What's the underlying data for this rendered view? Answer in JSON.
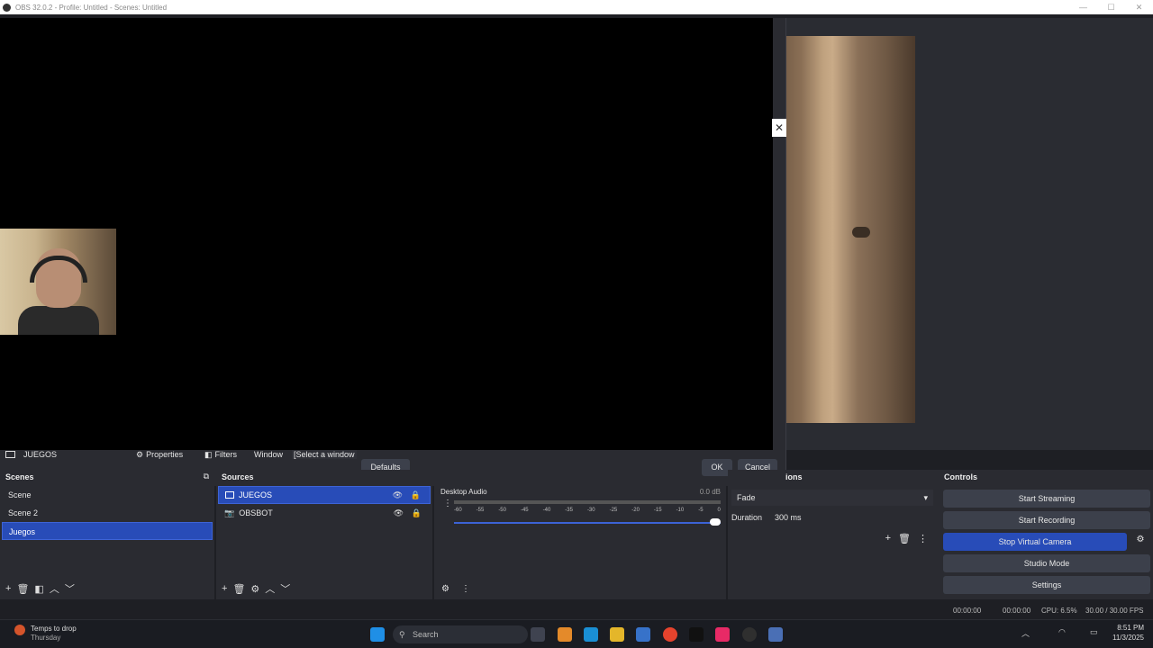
{
  "window": {
    "title": "OBS 32.0.2 - Profile: Untitled - Scenes: Untitled",
    "minimize": "—",
    "maximize": "☐",
    "close": "✕"
  },
  "dialog": {
    "close_glyph": "✕",
    "defaults_label": "Defaults",
    "ok_label": "OK",
    "cancel_label": "Cancel"
  },
  "source_toolbar": {
    "source_name": "JUEGOS",
    "properties_label": "Properties",
    "filters_label": "Filters",
    "window_label": "Window",
    "window_value": "[Select a window"
  },
  "scenes": {
    "title": "Scenes",
    "items": [
      {
        "label": "Scene"
      },
      {
        "label": "Scene 2"
      },
      {
        "label": "Juegos",
        "selected": true
      }
    ]
  },
  "sources": {
    "title": "Sources",
    "items": [
      {
        "label": "JUEGOS",
        "selected": true,
        "icon": "window-icon"
      },
      {
        "label": "OBSBOT",
        "icon": "camera-icon"
      }
    ]
  },
  "mixer": {
    "channel": "Desktop Audio",
    "level": "0.0 dB",
    "scale": [
      "-60",
      "-55",
      "-50",
      "-45",
      "-40",
      "-35",
      "-30",
      "-25",
      "-20",
      "-15",
      "-10",
      "-5",
      "0"
    ]
  },
  "transitions": {
    "title_partial": "ions",
    "selected": "Fade",
    "duration_label": "Duration",
    "duration_value": "300 ms"
  },
  "controls": {
    "title": "Controls",
    "start_streaming": "Start Streaming",
    "start_recording": "Start Recording",
    "stop_virtual_camera": "Stop Virtual Camera",
    "studio_mode": "Studio Mode",
    "settings": "Settings"
  },
  "status": {
    "stream_time": "00:00:00",
    "rec_time": "00:00:00",
    "cpu": "CPU: 6.5%",
    "fps": "30.00 / 30.00 FPS"
  },
  "taskbar": {
    "weather_line1": "Temps to drop",
    "weather_line2": "Thursday",
    "search_placeholder": "Search",
    "time": "8:51 PM",
    "date": "11/3/2025"
  },
  "colors": {
    "accent_blue": "#284cb8",
    "bg": "#1e1f24",
    "dock": "#2a2b31",
    "button": "#3c404b"
  }
}
